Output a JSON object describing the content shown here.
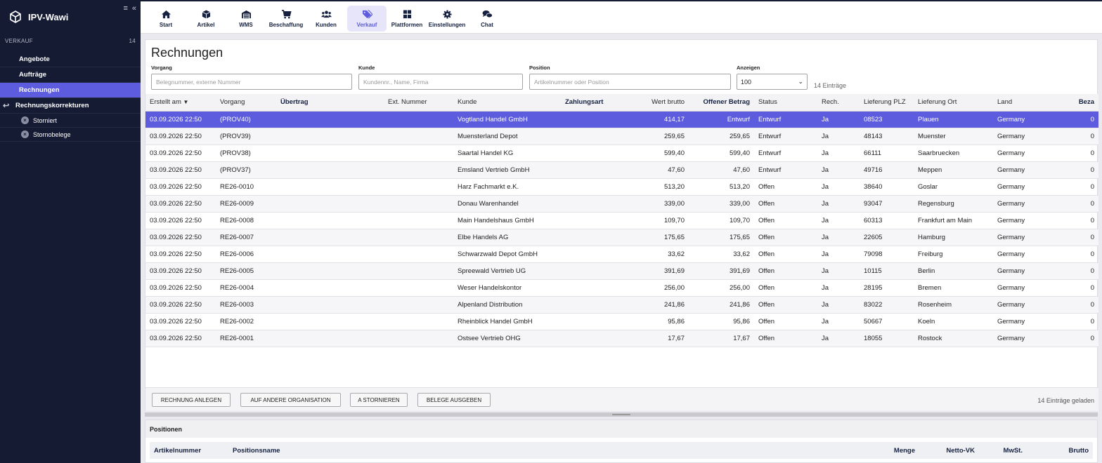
{
  "app": {
    "title": "IPV-Wawi"
  },
  "sidebar": {
    "section_label": "VERKAUF",
    "section_count": "14",
    "items": [
      {
        "label": "Angebote"
      },
      {
        "label": "Aufträge"
      },
      {
        "label": "Rechnungen"
      },
      {
        "label": "Rechnungskorrekturen"
      }
    ],
    "subitems": [
      {
        "label": "Storniert"
      },
      {
        "label": "Stornobelege"
      }
    ]
  },
  "nav": [
    {
      "label": "Start",
      "icon": "home-icon"
    },
    {
      "label": "Artikel",
      "icon": "box-icon"
    },
    {
      "label": "WMS",
      "icon": "warehouse-icon"
    },
    {
      "label": "Beschaffung",
      "icon": "cart-icon"
    },
    {
      "label": "Kunden",
      "icon": "users-icon"
    },
    {
      "label": "Verkauf",
      "icon": "tags-icon"
    },
    {
      "label": "Plattformen",
      "icon": "grid-icon"
    },
    {
      "label": "Einstellungen",
      "icon": "gear-icon"
    },
    {
      "label": "Chat",
      "icon": "chat-icon"
    }
  ],
  "page": {
    "title": "Rechnungen",
    "filters": {
      "vorgang": {
        "label": "Vorgang",
        "placeholder": "Belegnummer, externe Nummer"
      },
      "kunde": {
        "label": "Kunde",
        "placeholder": "Kundennr., Name, Firma"
      },
      "position": {
        "label": "Position",
        "placeholder": "Artikelnummer oder Position"
      },
      "anzeigen": {
        "label": "Anzeigen",
        "value": "100"
      }
    },
    "count_text": "14 Einträge"
  },
  "table": {
    "headers": [
      "Erstellt am",
      "Vorgang",
      "Übertrag",
      "Ext. Nummer",
      "Kunde",
      "Zahlungsart",
      "Wert brutto",
      "Offener Betrag",
      "Status",
      "Rech.",
      "Lieferung PLZ",
      "Lieferung Ort",
      "Land",
      "Beza"
    ],
    "rows": [
      [
        "03.09.2026 22:50",
        "(PROV40)",
        "",
        "",
        "Vogtland Handel GmbH",
        "",
        "414,17",
        "Entwurf",
        "Entwurf",
        "Ja",
        "08523",
        "Plauen",
        "Germany",
        "0"
      ],
      [
        "03.09.2026 22:50",
        "(PROV39)",
        "",
        "",
        "Muensterland Depot",
        "",
        "259,65",
        "259,65",
        "Entwurf",
        "Ja",
        "48143",
        "Muenster",
        "Germany",
        "0"
      ],
      [
        "03.09.2026 22:50",
        "(PROV38)",
        "",
        "",
        "Saartal Handel KG",
        "",
        "599,40",
        "599,40",
        "Entwurf",
        "Ja",
        "66111",
        "Saarbruecken",
        "Germany",
        "0"
      ],
      [
        "03.09.2026 22:50",
        "(PROV37)",
        "",
        "",
        "Emsland Vertrieb GmbH",
        "",
        "47,60",
        "47,60",
        "Entwurf",
        "Ja",
        "49716",
        "Meppen",
        "Germany",
        "0"
      ],
      [
        "03.09.2026 22:50",
        "RE26-0010",
        "",
        "",
        "Harz Fachmarkt e.K.",
        "",
        "513,20",
        "513,20",
        "Offen",
        "Ja",
        "38640",
        "Goslar",
        "Germany",
        "0"
      ],
      [
        "03.09.2026 22:50",
        "RE26-0009",
        "",
        "",
        "Donau Warenhandel",
        "",
        "339,00",
        "339,00",
        "Offen",
        "Ja",
        "93047",
        "Regensburg",
        "Germany",
        "0"
      ],
      [
        "03.09.2026 22:50",
        "RE26-0008",
        "",
        "",
        "Main Handelshaus GmbH",
        "",
        "109,70",
        "109,70",
        "Offen",
        "Ja",
        "60313",
        "Frankfurt am Main",
        "Germany",
        "0"
      ],
      [
        "03.09.2026 22:50",
        "RE26-0007",
        "",
        "",
        "Elbe Handels AG",
        "",
        "175,65",
        "175,65",
        "Offen",
        "Ja",
        "22605",
        "Hamburg",
        "Germany",
        "0"
      ],
      [
        "03.09.2026 22:50",
        "RE26-0006",
        "",
        "",
        "Schwarzwald Depot GmbH",
        "",
        "33,62",
        "33,62",
        "Offen",
        "Ja",
        "79098",
        "Freiburg",
        "Germany",
        "0"
      ],
      [
        "03.09.2026 22:50",
        "RE26-0005",
        "",
        "",
        "Spreewald Vertrieb UG",
        "",
        "391,69",
        "391,69",
        "Offen",
        "Ja",
        "10115",
        "Berlin",
        "Germany",
        "0"
      ],
      [
        "03.09.2026 22:50",
        "RE26-0004",
        "",
        "",
        "Weser Handelskontor",
        "",
        "256,00",
        "256,00",
        "Offen",
        "Ja",
        "28195",
        "Bremen",
        "Germany",
        "0"
      ],
      [
        "03.09.2026 22:50",
        "RE26-0003",
        "",
        "",
        "Alpenland Distribution",
        "",
        "241,86",
        "241,86",
        "Offen",
        "Ja",
        "83022",
        "Rosenheim",
        "Germany",
        "0"
      ],
      [
        "03.09.2026 22:50",
        "RE26-0002",
        "",
        "",
        "Rheinblick Handel GmbH",
        "",
        "95,86",
        "95,86",
        "Offen",
        "Ja",
        "50667",
        "Koeln",
        "Germany",
        "0"
      ],
      [
        "03.09.2026 22:50",
        "RE26-0001",
        "",
        "",
        "Ostsee Vertrieb OHG",
        "",
        "17,67",
        "17,67",
        "Offen",
        "Ja",
        "18055",
        "Rostock",
        "Germany",
        "0"
      ]
    ]
  },
  "footer": {
    "buttons": [
      "RECHNUNG ANLEGEN",
      "AUF ANDERE ORGANISATION",
      "A STORNIEREN",
      "BELEGE AUSGEBEN"
    ],
    "loaded_text": "14 Einträge geladen"
  },
  "positions": {
    "title": "Positionen",
    "columns": [
      "Artikelnummer",
      "Positionsname",
      "Menge",
      "Netto-VK",
      "MwSt.",
      "Brutto"
    ]
  },
  "colors": {
    "accent": "#5d5cde",
    "sidebar_bg": "#151b33"
  }
}
